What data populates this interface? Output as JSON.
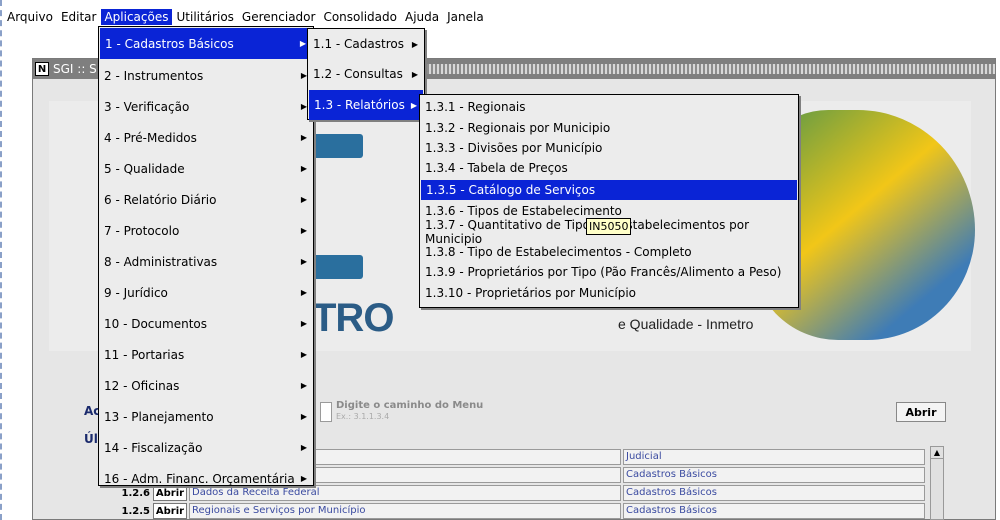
{
  "menubar": [
    "Arquivo",
    "Editar",
    "Aplicações",
    "Utilitários",
    "Gerenciador",
    "Consolidado",
    "Ajuda",
    "Janela"
  ],
  "window": {
    "title": "SGI :: S"
  },
  "banner": {
    "logo_text": "TRO",
    "slogan": "e Qualidade - Inmetro"
  },
  "panel": {
    "ac_label": "Ac",
    "un_label": "Úl",
    "path_label": "Digite o caminho do Menu",
    "path_example": "Ex.: 3.1.1.3.4",
    "open_button": "Abrir"
  },
  "rows": [
    {
      "code": "",
      "btn": "",
      "desc": "",
      "cat": "Judicial"
    },
    {
      "code": "",
      "btn": "",
      "desc": "",
      "cat": "Cadastros Básicos"
    },
    {
      "code": "1.2.6",
      "btn": "Abrir",
      "desc": "Dados da Receita Federal",
      "cat": "Cadastros Básicos"
    },
    {
      "code": "1.2.5",
      "btn": "Abrir",
      "desc": "Regionais e Serviços por Município",
      "cat": "Cadastros Básicos"
    }
  ],
  "menu1": [
    "1 - Cadastros Básicos",
    "2 - Instrumentos",
    "3 - Verificação",
    "4 - Pré-Medidos",
    "5 - Qualidade",
    "6 - Relatório Diário",
    "7 - Protocolo",
    "8 - Administrativas",
    "9 - Jurídico",
    "10 - Documentos",
    "11 - Portarias",
    "12 - Oficinas",
    "13 - Planejamento",
    "14 - Fiscalização",
    "16 - Adm. Financ. Orçamentária"
  ],
  "menu2": [
    "1.1 - Cadastros",
    "1.2 - Consultas",
    "1.3 - Relatórios"
  ],
  "menu3": [
    "1.3.1 - Regionais",
    "1.3.2 - Regionais por Municipio",
    "1.3.3 - Divisões por Município",
    "1.3.4 - Tabela de Preços",
    "1.3.5 - Catálogo de Serviços",
    "1.3.6 - Tipos de Estabelecimento",
    "1.3.7 - Quantitativo de Tipos de Estabelecimentos por Municipio",
    "1.3.8 - Tipo de Estabelecimentos - Completo",
    "1.3.9 - Proprietários por Tipo (Pão Francês/Alimento a Peso)",
    "1.3.10 - Proprietários por Município"
  ],
  "tooltip": "IN5050",
  "colors": {
    "selection": "#0a24d6",
    "menu_bg": "#ececec"
  }
}
